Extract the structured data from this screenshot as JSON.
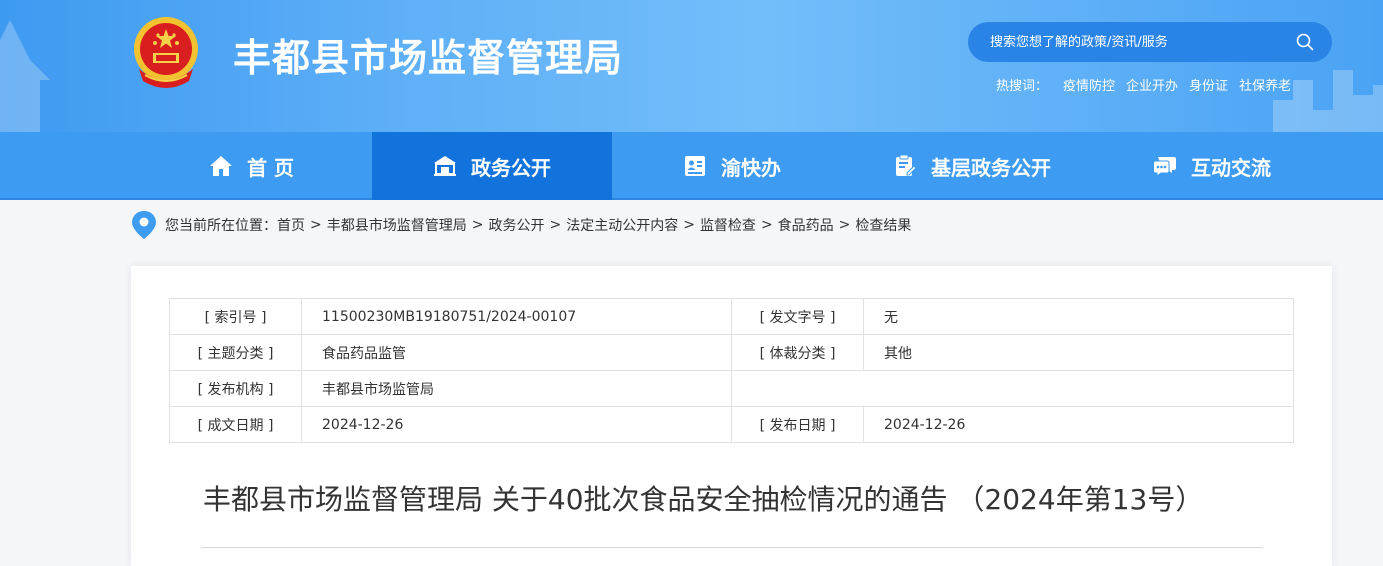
{
  "header": {
    "site_title": "丰都县市场监督管理局",
    "search_placeholder": "搜索您想了解的政策/资讯/服务",
    "hot_label": "热搜词：",
    "hot_words": [
      "疫情防控",
      "企业开办",
      "身份证",
      "社保养老"
    ]
  },
  "nav": {
    "items": [
      {
        "label": "首 页",
        "icon": "home-icon"
      },
      {
        "label": "政务公开",
        "icon": "government-building-icon"
      },
      {
        "label": "渝快办",
        "icon": "id-card-icon"
      },
      {
        "label": "基层政务公开",
        "icon": "document-edit-icon"
      },
      {
        "label": "互动交流",
        "icon": "chat-bubbles-icon"
      }
    ],
    "active": "政务公开"
  },
  "breadcrumb": {
    "prefix": "您当前所在位置：",
    "items": [
      "首页",
      "丰都县市场监督管理局",
      "政务公开",
      "法定主动公开内容",
      "监督检查",
      "食品药品",
      "检查结果"
    ],
    "separator": ">"
  },
  "meta": {
    "rows": [
      {
        "label1": "[ 索引号 ]",
        "value1": "11500230MB19180751/2024-00107",
        "label2": "[ 发文字号 ]",
        "value2": "无"
      },
      {
        "label1": "[ 主题分类 ]",
        "value1": "食品药品监管",
        "label2": "[ 体裁分类 ]",
        "value2": "其他"
      },
      {
        "label1": "[ 发布机构 ]",
        "value1": "丰都县市场监管局",
        "label2": "",
        "value2": ""
      },
      {
        "label1": "[ 成文日期 ]",
        "value1": "2024-12-26",
        "label2": "[ 发布日期 ]",
        "value2": "2024-12-26"
      }
    ]
  },
  "document": {
    "title": "丰都县市场监督管理局 关于40批次食品安全抽检情况的通告 （2024年第13号）"
  },
  "colors": {
    "header_blue": "#4aa3f4",
    "nav_blue": "#3e9bf2",
    "nav_active": "#1273dc",
    "search_bg": "#2a84e6",
    "pin_blue": "#3d9cf0"
  }
}
